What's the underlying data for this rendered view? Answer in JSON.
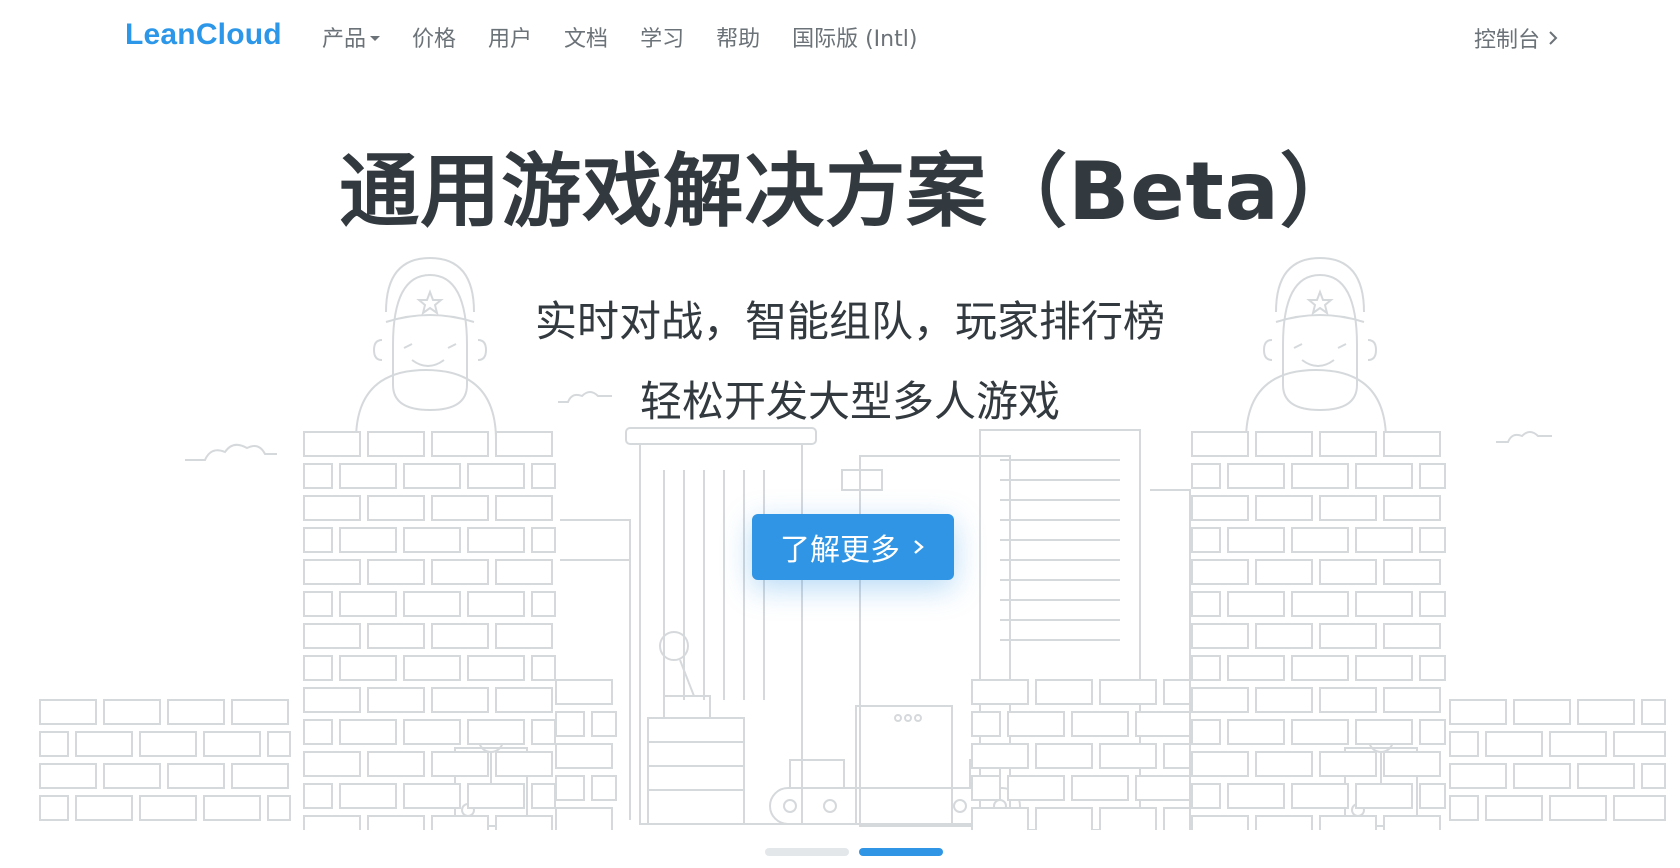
{
  "brand": {
    "name": "LeanCloud"
  },
  "nav": {
    "items": [
      {
        "label": "产品",
        "has_dropdown": true
      },
      {
        "label": "价格",
        "has_dropdown": false
      },
      {
        "label": "用户",
        "has_dropdown": false
      },
      {
        "label": "文档",
        "has_dropdown": false
      },
      {
        "label": "学习",
        "has_dropdown": false
      },
      {
        "label": "帮助",
        "has_dropdown": false
      },
      {
        "label": "国际版 (Intl)",
        "has_dropdown": false
      }
    ],
    "console_label": "控制台"
  },
  "hero": {
    "title": "通用游戏解决方案（Beta）",
    "subtitle_line1": "实时对战，智能组队，玩家排行榜",
    "subtitle_line2": "轻松开发大型多人游戏",
    "cta_label": "了解更多"
  },
  "carousel": {
    "slide_count": 2,
    "active_index": 1
  },
  "colors": {
    "brand": "#2c97e8",
    "cta": "#2f95e4",
    "text_dark": "#32393f",
    "nav_text": "#6b7278",
    "line_art": "#d6d9dc",
    "dot_inactive": "#e3e7ea",
    "dot_active": "#2f95e4"
  },
  "icons": {
    "dropdown": "caret-down-icon",
    "console": "chevron-right-icon",
    "cta": "chevron-right-icon"
  }
}
